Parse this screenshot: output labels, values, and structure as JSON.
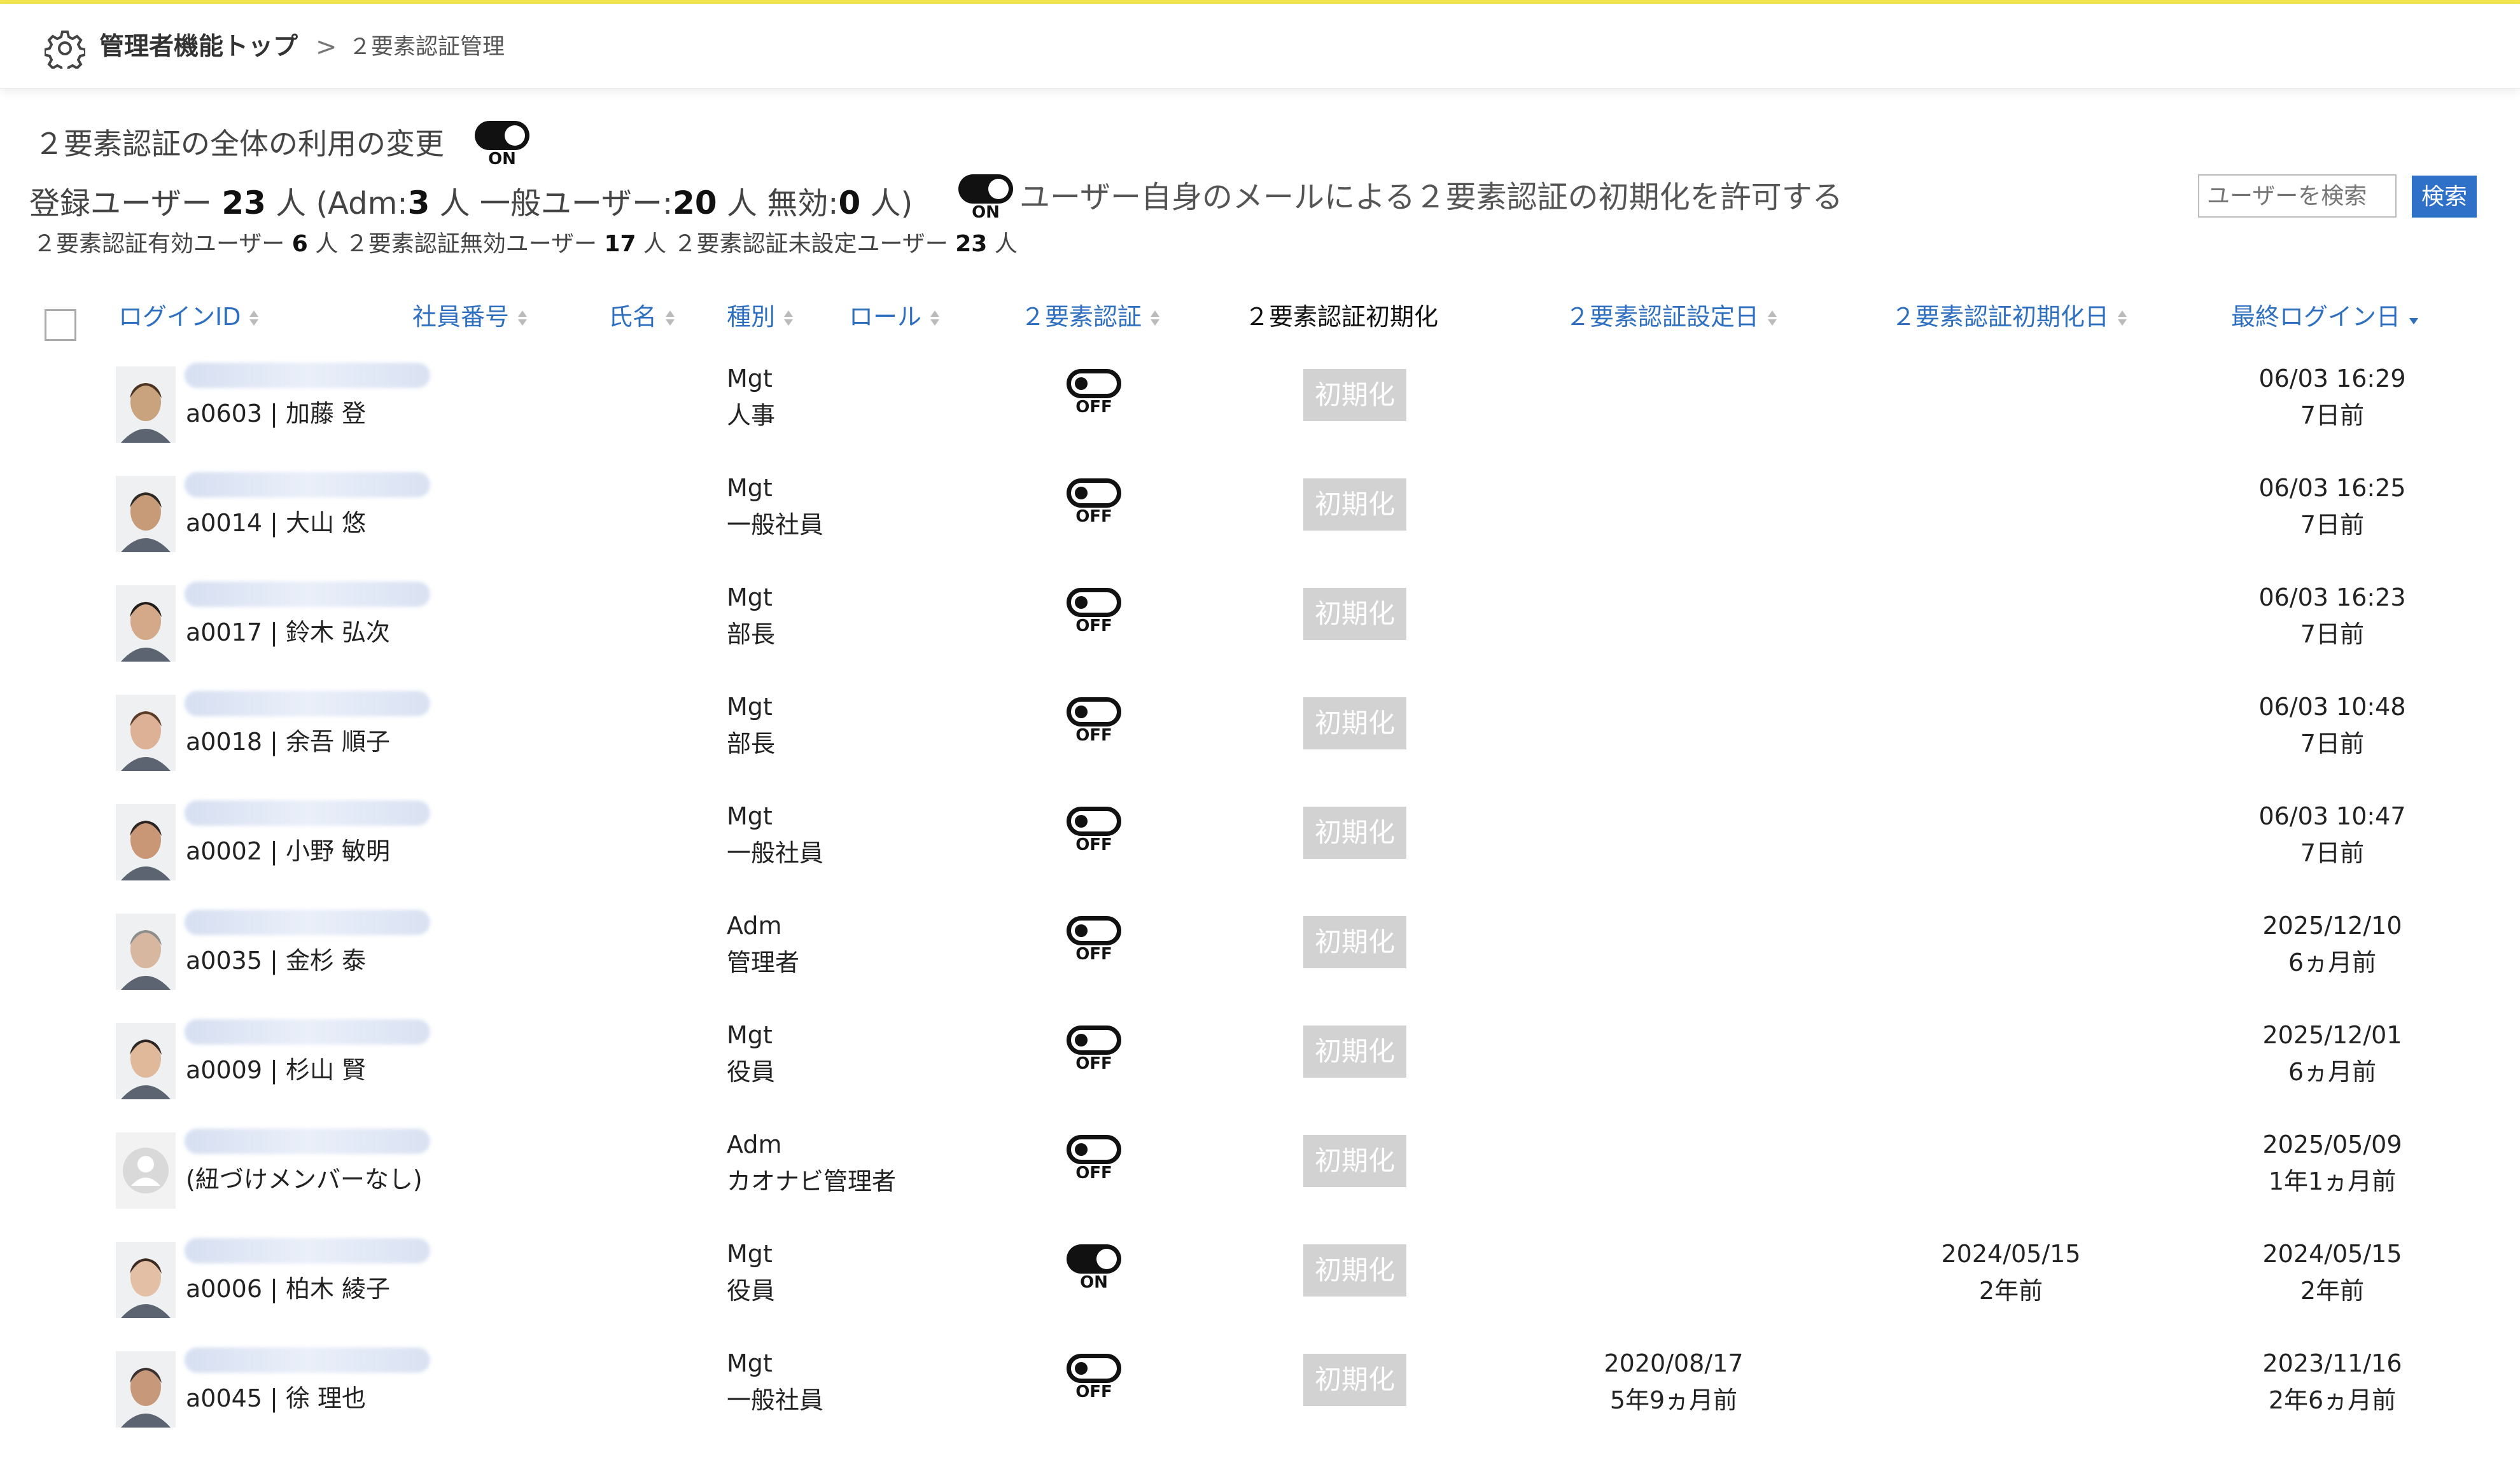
{
  "breadcrumb": {
    "home": "管理者機能トップ",
    "separator": ">",
    "current": "２要素認証管理"
  },
  "global_toggle": {
    "label": "２要素認証の全体の利用の変更",
    "state": "ON"
  },
  "stats": {
    "registered_label": "登録ユーザー",
    "registered": "23",
    "unit": "人",
    "adm_label": "(Adm:",
    "adm": "3",
    "general_label": "一般ユーザー:",
    "general": "20",
    "disabled_label": "無効:",
    "disabled": "0",
    "close": ")"
  },
  "substats": {
    "enabled_label": "２要素認証有効ユーザー",
    "enabled": "6",
    "invalid_label": "２要素認証無効ユーザー",
    "invalid": "17",
    "unset_label": "２要素認証未設定ユーザー",
    "unset": "23",
    "unit": "人"
  },
  "email_reset": {
    "label": "ユーザー自身のメールによる２要素認証の初期化を許可する",
    "state": "ON"
  },
  "search": {
    "placeholder": "ユーザーを検索",
    "button": "検索"
  },
  "columns": {
    "login_id": "ログインID",
    "employee_no": "社員番号",
    "name": "氏名",
    "kind": "種別",
    "role": "ロール",
    "two_factor": "２要素認証",
    "reset": "２要素認証初期化",
    "set_date": "２要素認証設定日",
    "init_date": "２要素認証初期化日",
    "last_login": "最終ログイン日"
  },
  "colors": {
    "accent": "#2f6fc0",
    "topline": "#f2e24c",
    "reset_button": "#d2d2d2"
  },
  "rows": [
    {
      "name": "a0603 | 加藤 登",
      "kind": "Mgt",
      "role": "人事",
      "tfa": "OFF",
      "reset": "初期化",
      "set_date": "",
      "set_ago": "",
      "init_date": "",
      "init_ago": "",
      "last_login": "06/03 16:29",
      "last_ago": "7日前",
      "avatar": "portrait-icon"
    },
    {
      "name": "a0014 | 大山 悠",
      "kind": "Mgt",
      "role": "一般社員",
      "tfa": "OFF",
      "reset": "初期化",
      "set_date": "",
      "set_ago": "",
      "init_date": "",
      "init_ago": "",
      "last_login": "06/03 16:25",
      "last_ago": "7日前",
      "avatar": "portrait-icon"
    },
    {
      "name": "a0017 | 鈴木 弘次",
      "kind": "Mgt",
      "role": "部長",
      "tfa": "OFF",
      "reset": "初期化",
      "set_date": "",
      "set_ago": "",
      "init_date": "",
      "init_ago": "",
      "last_login": "06/03 16:23",
      "last_ago": "7日前",
      "avatar": "portrait-icon"
    },
    {
      "name": "a0018 | 余吾 順子",
      "kind": "Mgt",
      "role": "部長",
      "tfa": "OFF",
      "reset": "初期化",
      "set_date": "",
      "set_ago": "",
      "init_date": "",
      "init_ago": "",
      "last_login": "06/03 10:48",
      "last_ago": "7日前",
      "avatar": "portrait-icon"
    },
    {
      "name": "a0002 | 小野 敏明",
      "kind": "Mgt",
      "role": "一般社員",
      "tfa": "OFF",
      "reset": "初期化",
      "set_date": "",
      "set_ago": "",
      "init_date": "",
      "init_ago": "",
      "last_login": "06/03 10:47",
      "last_ago": "7日前",
      "avatar": "portrait-icon"
    },
    {
      "name": "a0035 | 金杉 泰",
      "kind": "Adm",
      "role": "管理者",
      "tfa": "OFF",
      "reset": "初期化",
      "set_date": "",
      "set_ago": "",
      "init_date": "",
      "init_ago": "",
      "last_login": "2025/12/10",
      "last_ago": "6ヵ月前",
      "avatar": "portrait-icon"
    },
    {
      "name": "a0009 | 杉山 賢",
      "kind": "Mgt",
      "role": "役員",
      "tfa": "OFF",
      "reset": "初期化",
      "set_date": "",
      "set_ago": "",
      "init_date": "",
      "init_ago": "",
      "last_login": "2025/12/01",
      "last_ago": "6ヵ月前",
      "avatar": "portrait-icon"
    },
    {
      "name": "(紐づけメンバーなし)",
      "kind": "Adm",
      "role": "カオナビ管理者",
      "tfa": "OFF",
      "reset": "初期化",
      "set_date": "",
      "set_ago": "",
      "init_date": "",
      "init_ago": "",
      "last_login": "2025/05/09",
      "last_ago": "1年1ヵ月前",
      "avatar": "default-avatar-icon"
    },
    {
      "name": "a0006 | 柏木 綾子",
      "kind": "Mgt",
      "role": "役員",
      "tfa": "ON",
      "reset": "初期化",
      "set_date": "",
      "set_ago": "",
      "init_date": "2024/05/15",
      "init_ago": "2年前",
      "last_login": "2024/05/15",
      "last_ago": "2年前",
      "avatar": "portrait-icon"
    },
    {
      "name": "a0045 | 徐 理也",
      "kind": "Mgt",
      "role": "一般社員",
      "tfa": "OFF",
      "reset": "初期化",
      "set_date": "2020/08/17",
      "set_ago": "5年9ヵ月前",
      "init_date": "",
      "init_ago": "",
      "last_login": "2023/11/16",
      "last_ago": "2年6ヵ月前",
      "avatar": "portrait-icon"
    }
  ]
}
